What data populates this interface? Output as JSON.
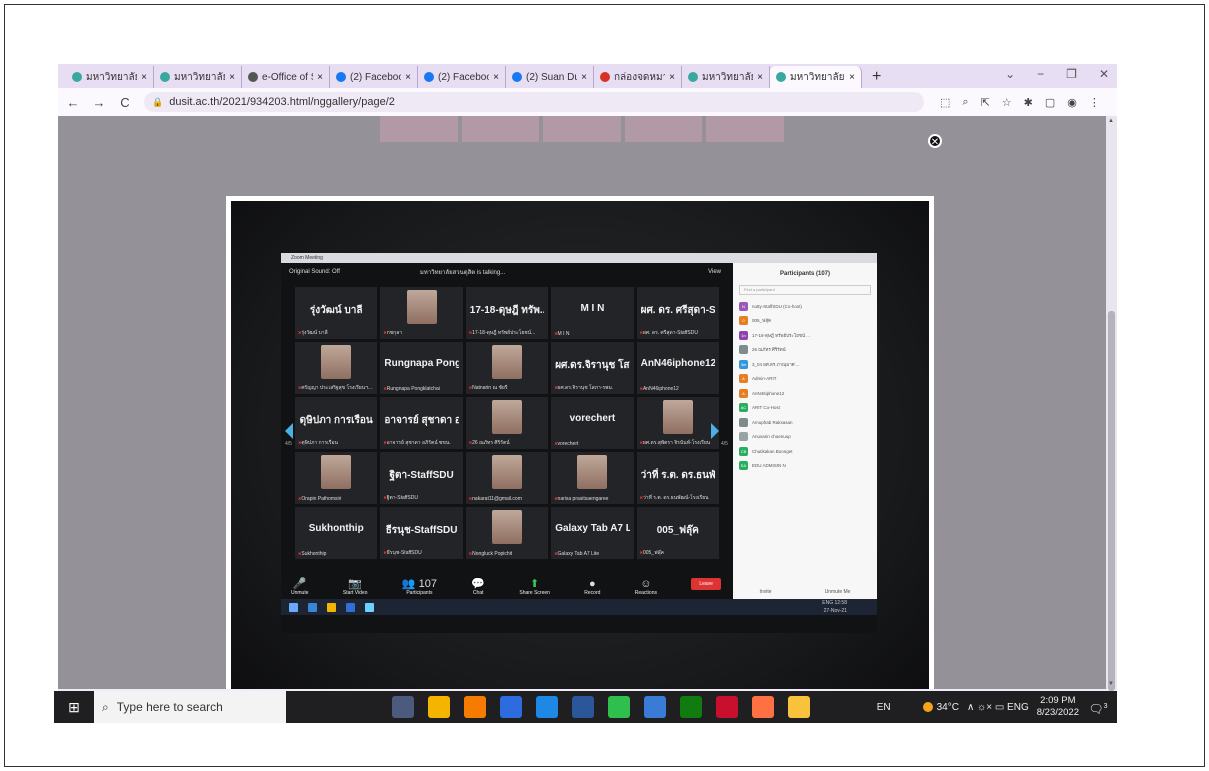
{
  "browser": {
    "tabs": [
      {
        "title": "มหาวิทยาลัยสวน",
        "icon": "#3aa8a0",
        "active": false
      },
      {
        "title": "มหาวิทยาลัยสวน",
        "icon": "#3aa8a0",
        "active": false
      },
      {
        "title": "e-Office of Su",
        "icon": "#555555",
        "active": false
      },
      {
        "title": "(2) Facebook",
        "icon": "#1877f2",
        "active": false
      },
      {
        "title": "(2) Facebook",
        "icon": "#1877f2",
        "active": false
      },
      {
        "title": "(2) Suan Dusit",
        "icon": "#1877f2",
        "active": false
      },
      {
        "title": "กล่องจดหมาย (",
        "icon": "#d93025",
        "active": false
      },
      {
        "title": "มหาวิทยาลัยสวน",
        "icon": "#3aa8a0",
        "active": false
      },
      {
        "title": "มหาวิทยาลัยสวน",
        "icon": "#3aa8a0",
        "active": true
      }
    ],
    "close_glyph": "×",
    "new_tab": "+",
    "window_controls": [
      "⌄",
      "−",
      "❐",
      "✕"
    ],
    "back": "←",
    "forward": "→",
    "reload": "C",
    "url": "dusit.ac.th/2021/934203.html/nggallery/page/2",
    "close_lightbox": "✕"
  },
  "zoom": {
    "window_title": "Zoom Meeting",
    "sound": "Original Sound: Off",
    "talking": "มหาวิทยาลัยสวนดุสิต is talking...",
    "view": "View",
    "page_left": "4/5",
    "page_right": "4/5",
    "tiles": [
      {
        "big": "รุ่งวัฒน์ บาลี",
        "sub": "รุ่งวัฒน์ บาลี",
        "face": false
      },
      {
        "big": "",
        "sub": "กชกุลา",
        "face": true
      },
      {
        "big": "17-18-ดุษฎี ทรัพ...",
        "sub": "17-18-ดุษฎี ทรัพย์ประโยชน์...",
        "face": false
      },
      {
        "big": "M I N",
        "sub": "M I N",
        "face": false
      },
      {
        "big": "ผศ. ดร. ศรีสุดา-S...",
        "sub": "ผศ. ดร. ศรีสุดา-StaffSDU",
        "face": false
      },
      {
        "big": "",
        "sub": "ศรัญญา ประเสริฐสุข โรงเรียนฯ...",
        "face": true
      },
      {
        "big": "Rungnapa Pong...",
        "sub": "Rungnapa Pongklatchai",
        "face": false
      },
      {
        "big": "",
        "sub": "Natnarin ณ ชัยรี",
        "face": true
      },
      {
        "big": "ผศ.ดร.จิรานุช โส...",
        "sub": "ผศ.ดร.จิรานุช โสภา-รพม.",
        "face": false
      },
      {
        "big": "AnN46iphone12",
        "sub": "AnN46iphone12",
        "face": false
      },
      {
        "big": "ดุษิปภา การเรือน",
        "sub": "ดุษิปภา การเรือน",
        "face": false
      },
      {
        "big": "อาจารย์ สุชาดา อ...",
        "sub": "อาจารย์ สุชาดา อภิรัตน์ ซขน.",
        "face": false
      },
      {
        "big": "",
        "sub": "26 ณภัทร ศิริรัตน์",
        "face": true
      },
      {
        "big": "vorechert",
        "sub": "vorechert",
        "face": false
      },
      {
        "big": "",
        "sub": "ผศ.ดร.สุพัตรา จิรนันท์-โรงเรียน",
        "face": true
      },
      {
        "big": "",
        "sub": "Orapin Pathomsiri",
        "face": true
      },
      {
        "big": "ฐิตา-StaffSDU",
        "sub": "ฐิตา-StaffSDU",
        "face": false
      },
      {
        "big": "",
        "sub": "nakarat11@gmail.com",
        "face": true
      },
      {
        "big": "",
        "sub": "narisa prasitsaengaree",
        "face": true
      },
      {
        "big": "ว่าที่ ร.ต. ดร.ธนพั...",
        "sub": "ว่าที่ ร.ต. ดร.ธนพัฒน์-โรงเรียน",
        "face": false
      },
      {
        "big": "Sukhonthip",
        "sub": "Sukhonthip",
        "face": false
      },
      {
        "big": "ธีรนุช-StaffSDU",
        "sub": "ธีรนุช-StaffSDU",
        "face": false
      },
      {
        "big": "",
        "sub": "Nongluck Popichit",
        "face": true
      },
      {
        "big": "Galaxy Tab A7 L...",
        "sub": "Galaxy Tab A7 Lite",
        "face": false
      },
      {
        "big": "005_ฟลุ๊ค",
        "sub": "005_ฟลุ๊ค",
        "face": false
      }
    ],
    "controls": [
      {
        "glyph": "🎤",
        "label": "Unmute"
      },
      {
        "glyph": "📷",
        "label": "Start Video"
      },
      {
        "glyph": "👥 107",
        "label": "Participants"
      },
      {
        "glyph": "💬",
        "label": "Chat"
      },
      {
        "glyph": "⬆",
        "label": "Share Screen"
      },
      {
        "glyph": "●",
        "label": "Record"
      },
      {
        "glyph": "☺",
        "label": "Reactions"
      }
    ],
    "leave": "Leave",
    "participants_title": "Participants (107)",
    "find_placeholder": "Find a participant",
    "participants": [
      {
        "name": "nutty-StaffSDU (Co-host)",
        "color": "#9b59b6",
        "initials": "N"
      },
      {
        "name": "005_ฟลุ๊ค",
        "color": "#e67e22",
        "initials": "0"
      },
      {
        "name": "17-18-ดุษฎี ทรัพย์ประโยชน์ ...",
        "color": "#8e44ad",
        "initials": "1n"
      },
      {
        "name": "26 ณภัทร ศิริรัตน์",
        "color": "#7f8c8d",
        "initials": ""
      },
      {
        "name": "3_04 ผศ.ดร.ภาณุมาศ ...",
        "color": "#3498db",
        "initials": "3m"
      },
      {
        "name": "Admin-ARIT",
        "color": "#e67e22",
        "initials": "A"
      },
      {
        "name": "AnN46iphone12",
        "color": "#e67e22",
        "initials": "A"
      },
      {
        "name": "ARIT Co-Host",
        "color": "#27ae60",
        "initials": "AC"
      },
      {
        "name": "Amuphab Raksasan",
        "color": "#7f8c8d",
        "initials": ""
      },
      {
        "name": "Anusarin chuenuup",
        "color": "#95a5a6",
        "initials": ""
      },
      {
        "name": "Chutikakan Boonget",
        "color": "#27ae60",
        "initials": "CB"
      },
      {
        "name": "EDU ADMISIN N",
        "color": "#27ae60",
        "initials": "EA"
      }
    ],
    "invite": "Invite",
    "unmute_me": "Unmute Me",
    "tablet_time": "12:58",
    "tablet_date": "27-Nov-21",
    "tablet_lang": "ENG"
  },
  "taskbar": {
    "start_glyph": "⊞",
    "search_glyph": "⌕",
    "search_placeholder": "Type here to search",
    "app_colors": [
      "#4c5b7d",
      "#f4b400",
      "#f57c00",
      "#2d6cdf",
      "#1e88e5",
      "#2b579a",
      "#2fbf4f",
      "#3a7bd5",
      "#107c10",
      "#c8102e",
      "#ff7043",
      "#f9c23c"
    ],
    "lang": "EN",
    "temp": "34°C",
    "tray_icons": "∧ ☼× ▭ ENG",
    "time": "2:09 PM",
    "date": "8/23/2022",
    "notif_glyph": "🗨",
    "notif_count": "3"
  }
}
